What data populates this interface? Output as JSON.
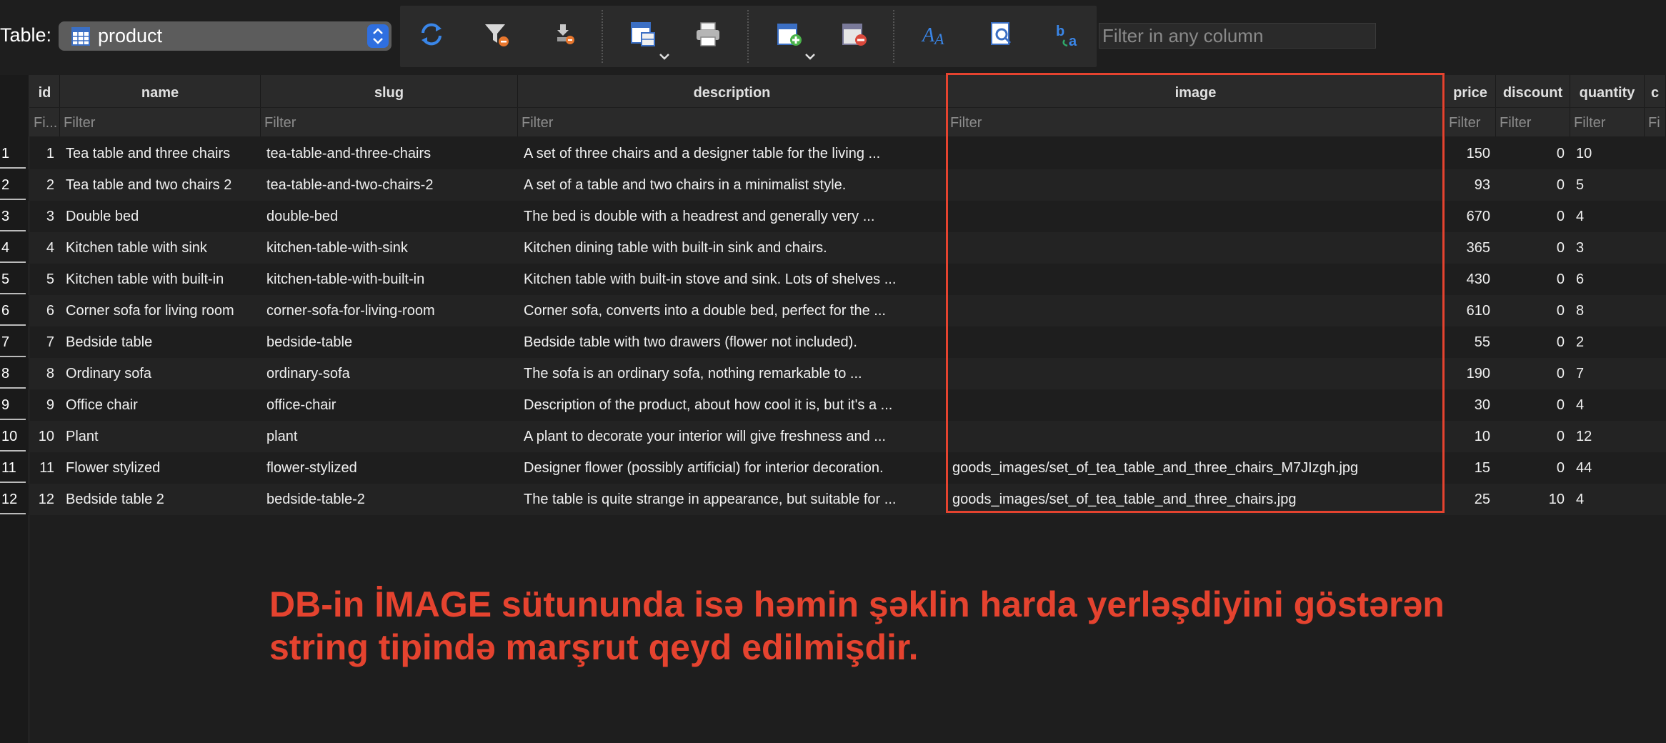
{
  "toolbar": {
    "table_label": "Table:",
    "table_value": "product",
    "filter_placeholder": "Filter in any column",
    "icons": [
      "refresh-icon",
      "clear-filters-icon",
      "delete-filter-icon",
      "save-table-icon",
      "print-icon",
      "insert-record-icon",
      "delete-record-icon",
      "font-icon",
      "find-icon",
      "replace-icon"
    ]
  },
  "columns": [
    {
      "label": "id",
      "filter": "Fi..."
    },
    {
      "label": "name",
      "filter": "Filter"
    },
    {
      "label": "slug",
      "filter": "Filter"
    },
    {
      "label": "description",
      "filter": "Filter"
    },
    {
      "label": "image",
      "filter": "Filter"
    },
    {
      "label": "price",
      "filter": "Filter"
    },
    {
      "label": "discount",
      "filter": "Filter"
    },
    {
      "label": "quantity",
      "filter": "Filter"
    },
    {
      "label": "c",
      "filter": "Fi"
    }
  ],
  "rows": [
    {
      "n": "1",
      "id": "1",
      "name": "Tea table and three chairs",
      "slug": "tea-table-and-three-chairs",
      "description": "A set of three chairs and a designer table for the living ...",
      "image": "",
      "price": "150",
      "discount": "0",
      "quantity": "10"
    },
    {
      "n": "2",
      "id": "2",
      "name": "Tea table and two chairs 2",
      "slug": "tea-table-and-two-chairs-2",
      "description": "A set of a table and two chairs in a minimalist style.",
      "image": "",
      "price": "93",
      "discount": "0",
      "quantity": "5"
    },
    {
      "n": "3",
      "id": "3",
      "name": "Double bed",
      "slug": "double-bed",
      "description": "The bed is double with a headrest and generally very ...",
      "image": "",
      "price": "670",
      "discount": "0",
      "quantity": "4"
    },
    {
      "n": "4",
      "id": "4",
      "name": "Kitchen table with sink",
      "slug": "kitchen-table-with-sink",
      "description": "Kitchen dining table with built-in sink and chairs.",
      "image": "",
      "price": "365",
      "discount": "0",
      "quantity": "3"
    },
    {
      "n": "5",
      "id": "5",
      "name": "Kitchen table with built-in",
      "slug": "kitchen-table-with-built-in",
      "description": "Kitchen table with built-in stove and sink. Lots of shelves ...",
      "image": "",
      "price": "430",
      "discount": "0",
      "quantity": "6"
    },
    {
      "n": "6",
      "id": "6",
      "name": "Corner sofa for living room",
      "slug": "corner-sofa-for-living-room",
      "description": "Corner sofa, converts into a double bed, perfect for the ...",
      "image": "",
      "price": "610",
      "discount": "0",
      "quantity": "8"
    },
    {
      "n": "7",
      "id": "7",
      "name": "Bedside table",
      "slug": "bedside-table",
      "description": "Bedside table with two drawers (flower not included).",
      "image": "",
      "price": "55",
      "discount": "0",
      "quantity": "2"
    },
    {
      "n": "8",
      "id": "8",
      "name": "Ordinary sofa",
      "slug": "ordinary-sofa",
      "description": "The sofa is an ordinary sofa, nothing remarkable to ...",
      "image": "",
      "price": "190",
      "discount": "0",
      "quantity": "7"
    },
    {
      "n": "9",
      "id": "9",
      "name": "Office chair",
      "slug": "office-chair",
      "description": "Description of the product, about how cool it is, but it's a ...",
      "image": "",
      "price": "30",
      "discount": "0",
      "quantity": "4"
    },
    {
      "n": "10",
      "id": "10",
      "name": "Plant",
      "slug": "plant",
      "description": "A plant to decorate your interior will give freshness and ...",
      "image": "",
      "price": "10",
      "discount": "0",
      "quantity": "12"
    },
    {
      "n": "11",
      "id": "11",
      "name": "Flower stylized",
      "slug": "flower-stylized",
      "description": "Designer flower (possibly artificial) for interior decoration.",
      "image": "goods_images/set_of_tea_table_and_three_chairs_M7JIzgh.jpg",
      "price": "15",
      "discount": "0",
      "quantity": "44"
    },
    {
      "n": "12",
      "id": "12",
      "name": "Bedside table 2",
      "slug": "bedside-table-2",
      "description": "The table is quite strange in appearance, but suitable for ...",
      "image": "goods_images/set_of_tea_table_and_three_chairs.jpg",
      "price": "25",
      "discount": "10",
      "quantity": "4"
    }
  ],
  "annotation": {
    "line1": "DB-in İMAGE sütununda isə həmin şəklin harda yerləşdiyini göstərən",
    "line2": "string tipində marşrut qeyd edilmişdir."
  },
  "colors": {
    "highlight": "#e5432f",
    "background": "#1e1e1e",
    "accent": "#2f6fe0"
  }
}
